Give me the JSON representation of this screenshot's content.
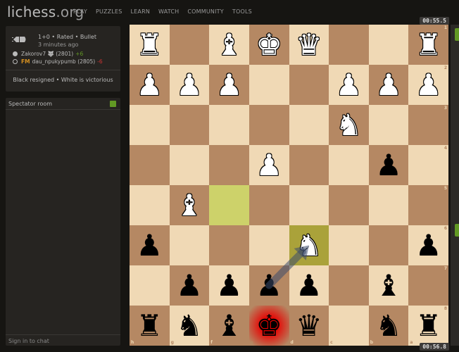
{
  "header": {
    "logo_main": "lichess",
    "logo_tld": ".org",
    "nav": [
      "PLAY",
      "PUZZLES",
      "LEARN",
      "WATCH",
      "COMMUNITY",
      "TOOLS"
    ]
  },
  "game": {
    "icon": "bullet-icon",
    "meta": "1+0 • Rated • Bullet",
    "time_ago": "3 minutes ago",
    "white_player": "Zakorov7 🐺 (2801)",
    "white_diff": "+6",
    "black_title": "FM",
    "black_player": "dau_npukypumb (2805)",
    "black_diff": "-6",
    "result": "Black resigned • White is victorious"
  },
  "chat": {
    "title": "Spectator room",
    "input_placeholder": "Sign in to chat",
    "toggle_color": "#629924"
  },
  "clocks": {
    "top": "00:55.5",
    "bottom": "00:56.8"
  },
  "board": {
    "orientation": "black",
    "files": [
      "h",
      "g",
      "f",
      "e",
      "d",
      "c",
      "b",
      "a"
    ],
    "ranks": [
      "1",
      "2",
      "3",
      "4",
      "5",
      "6",
      "7",
      "8"
    ],
    "rows": [
      [
        "wR",
        "",
        "wB",
        "wK",
        "wQ",
        "",
        "",
        "wR"
      ],
      [
        "wP",
        "wP",
        "wP",
        "",
        "",
        "wP",
        "wP",
        "wP"
      ],
      [
        "",
        "",
        "",
        "",
        "",
        "wN",
        "",
        ""
      ],
      [
        "",
        "",
        "",
        "wP",
        "",
        "",
        "bP",
        ""
      ],
      [
        "",
        "wB",
        "",
        "",
        "",
        "",
        "",
        ""
      ],
      [
        "bP",
        "",
        "",
        "",
        "wN",
        "",
        "",
        "bP"
      ],
      [
        "",
        "bP",
        "bP",
        "bP",
        "bP",
        "",
        "bB",
        ""
      ],
      [
        "bR",
        "bN",
        "bB",
        "bK",
        "bQ",
        "",
        "bN",
        "bR"
      ]
    ],
    "last_move_squares": [
      "f5",
      "d6"
    ],
    "check_square": "e8",
    "arrow": {
      "from": "e7",
      "to": "d6",
      "color": "#15781b"
    },
    "colors": {
      "light": "#f0d9b5",
      "dark": "#b58863",
      "last_move": "#cdd26a"
    }
  }
}
